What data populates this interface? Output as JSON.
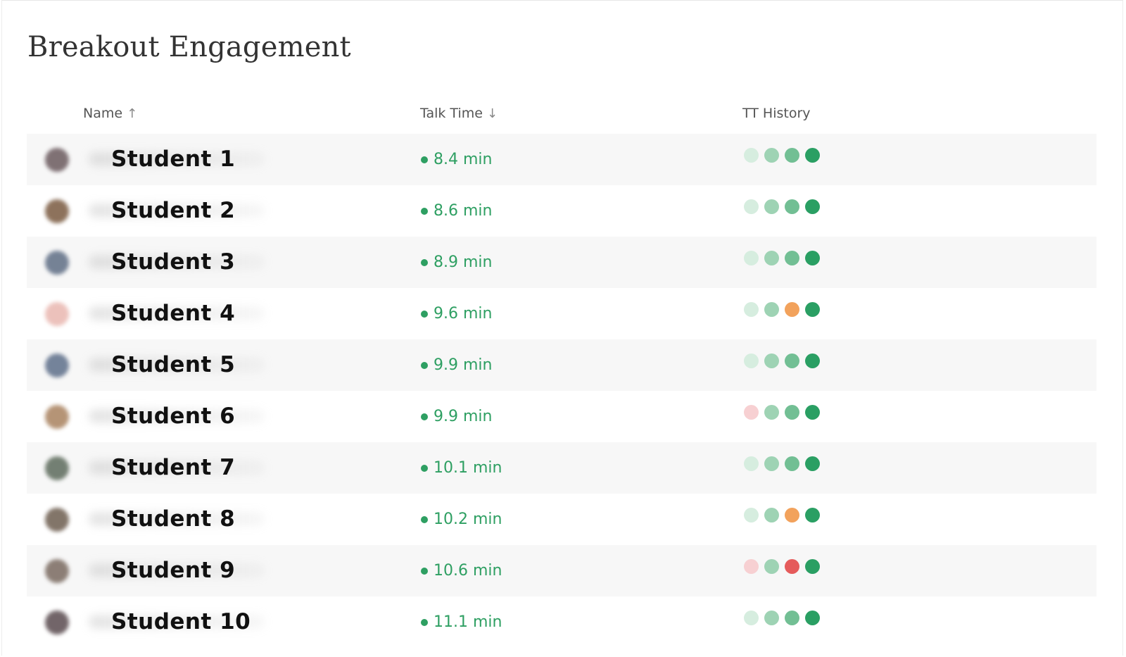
{
  "title": "Breakout Engagement",
  "columns": {
    "name": "Name",
    "name_sort": "↑",
    "talk_time": "Talk Time",
    "talk_sort": "↓",
    "history": "TT History"
  },
  "colors": {
    "light_green": "#d6eddf",
    "mid_green": "#9ed3b4",
    "green": "#72bf94",
    "dark_green": "#2a9f63",
    "orange": "#f2a25c",
    "pink": "#f7d0d2",
    "red": "#e55b5b",
    "talk_text": "#2e9f62"
  },
  "rows": [
    {
      "name": "Student 1",
      "talk": "8.4 min",
      "history": [
        "light_green",
        "mid_green",
        "green",
        "dark_green"
      ],
      "avatar_color": "#6b5a5e"
    },
    {
      "name": "Student 2",
      "talk": "8.6 min",
      "history": [
        "light_green",
        "mid_green",
        "green",
        "dark_green"
      ],
      "avatar_color": "#7a5a40"
    },
    {
      "name": "Student 3",
      "talk": "8.9 min",
      "history": [
        "light_green",
        "mid_green",
        "green",
        "dark_green"
      ],
      "avatar_color": "#5f6e85"
    },
    {
      "name": "Student 4",
      "talk": "9.6 min",
      "history": [
        "light_green",
        "mid_green",
        "orange",
        "dark_green"
      ],
      "avatar_color": "#e9b7b0"
    },
    {
      "name": "Student 5",
      "talk": "9.9 min",
      "history": [
        "light_green",
        "mid_green",
        "green",
        "dark_green"
      ],
      "avatar_color": "#5e6f8a"
    },
    {
      "name": "Student 6",
      "talk": "9.9 min",
      "history": [
        "pink",
        "mid_green",
        "green",
        "dark_green"
      ],
      "avatar_color": "#a9825f"
    },
    {
      "name": "Student 7",
      "talk": "10.1 min",
      "history": [
        "light_green",
        "mid_green",
        "green",
        "dark_green"
      ],
      "avatar_color": "#5d6b5c"
    },
    {
      "name": "Student 8",
      "talk": "10.2 min",
      "history": [
        "light_green",
        "mid_green",
        "orange",
        "dark_green"
      ],
      "avatar_color": "#6d5d4f"
    },
    {
      "name": "Student 9",
      "talk": "10.6 min",
      "history": [
        "pink",
        "mid_green",
        "red",
        "dark_green"
      ],
      "avatar_color": "#7a6a60"
    },
    {
      "name": "Student 10",
      "talk": "11.1 min",
      "history": [
        "light_green",
        "mid_green",
        "green",
        "dark_green"
      ],
      "avatar_color": "#5a4b4f"
    }
  ]
}
